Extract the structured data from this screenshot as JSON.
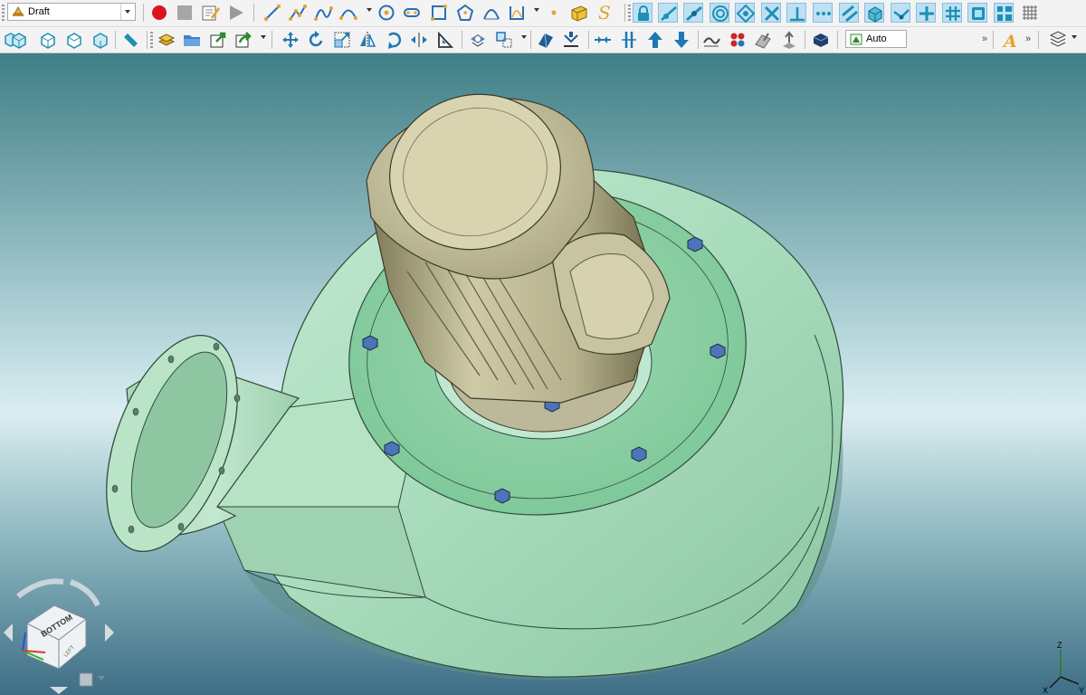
{
  "toolbar": {
    "style_combo": {
      "value": "Draft",
      "icon": "draft-style-icon"
    },
    "mode_field": {
      "value": "Auto",
      "icon": "auto-view-icon"
    },
    "overflow_glyph": "»"
  },
  "viewport": {
    "model": "centrifugal-fan-with-motor",
    "nav_cube": {
      "face_label": "BOTTOM",
      "side_label": "LEFT"
    },
    "triad": {
      "axes": [
        "X",
        "Y",
        "Z"
      ]
    }
  },
  "colors": {
    "housing": "#a8dcbc",
    "motor": "#c9c5a4",
    "bolt": "#4d74b8",
    "toolbar_bg": "#f3f3f3",
    "highlight": "#bde0f4"
  }
}
